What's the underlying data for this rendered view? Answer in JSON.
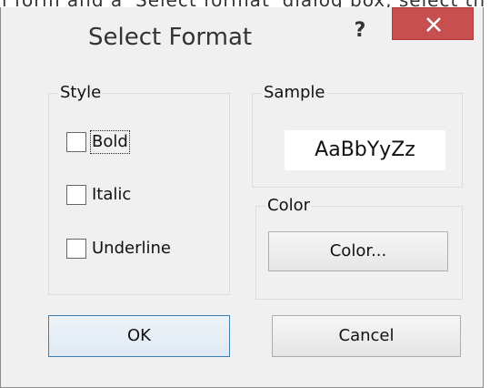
{
  "top_strip_text": "l form and a 'Select format' dialog box, select th",
  "dialog": {
    "title": "Select Format",
    "help_label": "?",
    "style_group": {
      "label": "Style",
      "options": [
        {
          "label": "Bold",
          "checked": false,
          "focused": true
        },
        {
          "label": "Italic",
          "checked": false
        },
        {
          "label": "Underline",
          "checked": false
        }
      ]
    },
    "sample_group": {
      "label": "Sample",
      "text": "AaBbYyZz"
    },
    "color_group": {
      "label": "Color",
      "button_label": "Color..."
    },
    "ok_label": "OK",
    "cancel_label": "Cancel"
  },
  "colors": {
    "close_button": "#c84f4f",
    "dialog_background": "#f0f0f0",
    "default_button_border": "#3c7fb1"
  }
}
